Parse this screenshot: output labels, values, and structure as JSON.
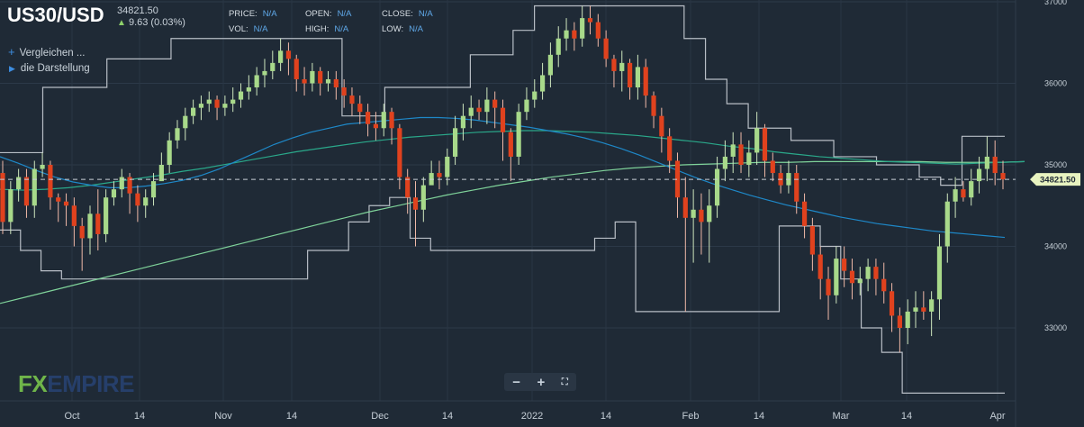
{
  "header": {
    "symbol": "US30/USD",
    "last_price": "34821.50",
    "change": "9.63 (0.03%)",
    "price_label": "PRICE:",
    "price_value": "N/A",
    "open_label": "OPEN:",
    "open_value": "N/A",
    "close_label": "CLOSE:",
    "close_value": "N/A",
    "vol_label": "VOL:",
    "vol_value": "N/A",
    "high_label": "HIGH:",
    "high_value": "N/A",
    "low_label": "LOW:",
    "low_value": "N/A"
  },
  "sidebar": {
    "compare_label": "Vergleichen ...",
    "display_label": "die Darstellung"
  },
  "logo": {
    "fx": "FX",
    "empire": "EMPIRE"
  },
  "zoom": {
    "minus": "−",
    "plus": "+",
    "fullscreen": "⛶"
  },
  "colors": {
    "background": "#1f2a36",
    "up": "#a8d98a",
    "down": "#e0421e",
    "ma_blue": "#1e88c8",
    "ma_teal": "#2aa88a",
    "ma_green": "#7fd39a",
    "channel": "#b8bec6",
    "last_price_tag": "#e8f3c0"
  },
  "chart_data": {
    "type": "candlestick",
    "y_axis": {
      "min": 32100,
      "max": 37050,
      "ticks": [
        33000,
        34000,
        35000,
        36000,
        37000
      ],
      "position": "right"
    },
    "x_axis_labels": [
      "Oct",
      "14",
      "Nov",
      "14",
      "Dec",
      "14",
      "2022",
      "14",
      "Feb",
      "14",
      "Mar",
      "14",
      "Apr"
    ],
    "last_price": 34821.5,
    "last_price_label": "34821.50",
    "candles_start": [
      34900,
      34300,
      34700,
      34850,
      34500,
      34950,
      35000,
      34600,
      34550,
      34500,
      34250,
      34100,
      34400,
      34150,
      34600,
      34700,
      34850,
      34650,
      34500,
      34600,
      34800,
      35000,
      35300,
      35450,
      35600,
      35700,
      35750,
      35800,
      35700,
      35750,
      35800,
      35900,
      35950,
      36100,
      36150,
      36250,
      36400,
      36300,
      36050,
      36000,
      36150,
      36000,
      36050,
      35950,
      35850,
      35750,
      35650,
      35500,
      35450,
      35650,
      35450,
      34850,
      34600,
      34450,
      34750,
      34900,
      34850,
      35100,
      35450,
      35600,
      35700,
      35650,
      35800,
      35700,
      35400,
      35100,
      35650,
      35800,
      35900,
      36100,
      36350,
      36550,
      36650,
      36550,
      36800,
      36750,
      36550,
      36300,
      36150,
      36250,
      35950,
      36200,
      35850,
      35600,
      35350,
      35050,
      34600,
      34350,
      34450,
      34300,
      34500,
      34950,
      35100,
      35250,
      35000,
      35150,
      35450,
      35050,
      34900,
      34750,
      34900,
      34550,
      34250,
      33900,
      33600,
      33400,
      33850,
      33700,
      33550,
      33600,
      33750,
      33600,
      33450,
      33150,
      33000,
      33200,
      33250,
      33200,
      33350,
      34000,
      34550,
      34700,
      34600,
      34800,
      34950,
      35100,
      34900
    ],
    "candles_end": [
      34300,
      34700,
      34850,
      34500,
      34950,
      35000,
      34600,
      34550,
      34500,
      34250,
      34100,
      34400,
      34150,
      34600,
      34700,
      34850,
      34650,
      34500,
      34600,
      34800,
      35000,
      35300,
      35450,
      35600,
      35700,
      35750,
      35800,
      35700,
      35750,
      35800,
      35900,
      35950,
      36100,
      36150,
      36250,
      36400,
      36300,
      36050,
      36000,
      36150,
      36000,
      36050,
      35950,
      35850,
      35750,
      35650,
      35500,
      35450,
      35650,
      35450,
      34850,
      34600,
      34450,
      34750,
      34900,
      34850,
      35100,
      35450,
      35600,
      35700,
      35650,
      35800,
      35700,
      35400,
      35100,
      35650,
      35800,
      35900,
      36100,
      36350,
      36550,
      36650,
      36550,
      36800,
      36750,
      36550,
      36300,
      36150,
      36250,
      35950,
      36200,
      35850,
      35600,
      35350,
      35050,
      34600,
      34350,
      34450,
      34300,
      34500,
      34950,
      35100,
      35250,
      35000,
      35150,
      35450,
      35050,
      34900,
      34750,
      34900,
      34550,
      34250,
      33900,
      33600,
      33400,
      33850,
      33700,
      33550,
      33600,
      33750,
      33600,
      33450,
      33150,
      33000,
      33200,
      33250,
      33200,
      33350,
      34000,
      34550,
      34700,
      34600,
      34800,
      34950,
      35100,
      34900,
      34821.5
    ],
    "candles_low": [
      34150,
      34150,
      34550,
      34350,
      34350,
      34850,
      34450,
      34300,
      34250,
      34000,
      33700,
      33900,
      33950,
      34050,
      34500,
      34600,
      34400,
      34300,
      34350,
      34500,
      34850,
      34900,
      35200,
      35300,
      35500,
      35550,
      35650,
      35550,
      35600,
      35650,
      35700,
      35800,
      35850,
      35950,
      36050,
      36150,
      36100,
      35900,
      35850,
      35900,
      35850,
      35900,
      35800,
      35700,
      35600,
      35500,
      35350,
      35300,
      35350,
      35250,
      34700,
      34400,
      34000,
      34300,
      34800,
      34700,
      34750,
      35000,
      35300,
      35450,
      35550,
      35500,
      35450,
      35050,
      34800,
      35000,
      35550,
      35700,
      35800,
      35950,
      36200,
      36400,
      36400,
      36450,
      36600,
      36450,
      36200,
      35950,
      35900,
      35800,
      35800,
      35700,
      35450,
      35150,
      34900,
      34350,
      33200,
      33800,
      33900,
      33800,
      34350,
      34800,
      34900,
      34900,
      34850,
      35000,
      34850,
      34800,
      34650,
      34650,
      34400,
      34100,
      33700,
      33350,
      33100,
      33300,
      33500,
      33350,
      33400,
      33450,
      33400,
      33300,
      32950,
      32700,
      32800,
      33000,
      33100,
      32900,
      33100,
      33800,
      34350,
      34550,
      34500,
      34650,
      34800,
      34750,
      34700
    ],
    "candles_high": [
      35050,
      34800,
      34950,
      34950,
      35050,
      35150,
      35050,
      34650,
      34650,
      34600,
      34350,
      34500,
      34700,
      34700,
      34800,
      34950,
      34900,
      34750,
      34700,
      34900,
      35150,
      35400,
      35550,
      35700,
      35800,
      35850,
      35900,
      35850,
      35850,
      35950,
      36000,
      36100,
      36200,
      36300,
      36400,
      36550,
      36500,
      36350,
      36200,
      36250,
      36200,
      36150,
      36150,
      36050,
      35950,
      35850,
      35750,
      35650,
      35750,
      35700,
      35500,
      34950,
      34800,
      34850,
      35050,
      35050,
      35200,
      35600,
      35750,
      35850,
      35800,
      35950,
      35900,
      35800,
      35450,
      35750,
      35950,
      36050,
      36250,
      36500,
      36700,
      36800,
      36750,
      36950,
      36950,
      36850,
      36650,
      36350,
      36400,
      36300,
      36350,
      36300,
      35900,
      35700,
      35450,
      35150,
      34850,
      34700,
      34650,
      34700,
      35100,
      35300,
      35400,
      35400,
      35300,
      35650,
      35500,
      35150,
      35000,
      35050,
      35000,
      34650,
      34350,
      34000,
      33750,
      34000,
      34000,
      33850,
      33750,
      33850,
      33850,
      33800,
      33550,
      33250,
      33350,
      33450,
      33450,
      33450,
      34150,
      34650,
      34850,
      34800,
      34950,
      35100,
      35350,
      35300,
      35050
    ],
    "ma_blue_values": [
      35100,
      35020,
      34930,
      34850,
      34790,
      34750,
      34720,
      34720,
      34740,
      34770,
      34810,
      34870,
      34950,
      35050,
      35150,
      35250,
      35330,
      35400,
      35450,
      35500,
      35520,
      35540,
      35560,
      35580,
      35580,
      35570,
      35550,
      35520,
      35490,
      35460,
      35420,
      35380,
      35330,
      35270,
      35200,
      35120,
      35030,
      34940,
      34850,
      34770,
      34700,
      34630,
      34570,
      34510,
      34460,
      34410,
      34360,
      34320,
      34280,
      34250,
      34220,
      34190,
      34170,
      34150,
      34130,
      34110
    ],
    "ma_teal_values": [
      34700,
      34690,
      34700,
      34720,
      34750,
      34790,
      34830,
      34870,
      34920,
      34960,
      35010,
      35060,
      35110,
      35160,
      35200,
      35240,
      35280,
      35310,
      35340,
      35360,
      35380,
      35400,
      35410,
      35420,
      35420,
      35410,
      35400,
      35380,
      35360,
      35330,
      35300,
      35270,
      35230,
      35200,
      35160,
      35130,
      35100,
      35080,
      35060,
      35040,
      35030,
      35020,
      35010,
      35020,
      35030,
      35040
    ],
    "ma_green_values": [
      33300,
      33380,
      33460,
      33540,
      33620,
      33700,
      33780,
      33860,
      33940,
      34020,
      34100,
      34180,
      34260,
      34340,
      34420,
      34490,
      34560,
      34630,
      34690,
      34750,
      34800,
      34850,
      34890,
      34930,
      34960,
      34980,
      35000,
      35010,
      35020,
      35030,
      35030,
      35040,
      35040,
      35040,
      35040,
      35040,
      35030,
      35030,
      35030,
      35040
    ],
    "channel_upper_values": [
      35150,
      35150,
      35950,
      35950,
      35950,
      36300,
      36300,
      36300,
      36550,
      36550,
      36550,
      36550,
      36550,
      36550,
      36550,
      36550,
      35600,
      35600,
      35950,
      35950,
      35950,
      35950,
      36350,
      36350,
      36650,
      36950,
      36950,
      36950,
      36950,
      36950,
      36950,
      36950,
      36550,
      36050,
      35750,
      35450,
      35450,
      35300,
      35300,
      35100,
      35100,
      35000,
      35000,
      34850,
      34750,
      35350,
      35350,
      35350
    ],
    "channel_lower_values": [
      34200,
      33950,
      33700,
      33600,
      33600,
      33600,
      33600,
      33600,
      33600,
      33600,
      33600,
      33600,
      33600,
      33600,
      33600,
      33950,
      33950,
      34300,
      34500,
      34600,
      34100,
      33950,
      33950,
      33950,
      33950,
      33950,
      33950,
      33950,
      33950,
      34100,
      34300,
      33200,
      33200,
      33200,
      33200,
      33200,
      33200,
      33200,
      34250,
      34250,
      34000,
      33600,
      33000,
      32700,
      32200,
      32200,
      32200,
      32200,
      32200,
      32200
    ]
  }
}
